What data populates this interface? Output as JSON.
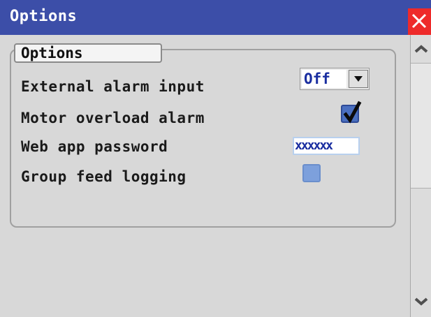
{
  "window": {
    "title": "Options"
  },
  "group": {
    "label": "Options"
  },
  "settings": {
    "external_alarm_input": {
      "label": "External alarm input",
      "value": "Off"
    },
    "motor_overload_alarm": {
      "label": "Motor overload alarm",
      "checked": true
    },
    "web_app_password": {
      "label": "Web app password",
      "value": "xxxxxx"
    },
    "group_feed_logging": {
      "label": "Group feed logging",
      "checked": false
    }
  },
  "icons": {
    "close": "close-icon",
    "dropdown": "chevron-down-icon",
    "check": "checkmark-icon",
    "scroll_up": "chevron-up-icon",
    "scroll_down": "chevron-down-icon"
  },
  "colors": {
    "titlebar": "#3c4ea8",
    "close": "#ee2a2a",
    "value_text": "#1a2ea0",
    "checkbox_checked": "#4a6fc0",
    "checkbox_unchecked": "#7da0dc"
  }
}
